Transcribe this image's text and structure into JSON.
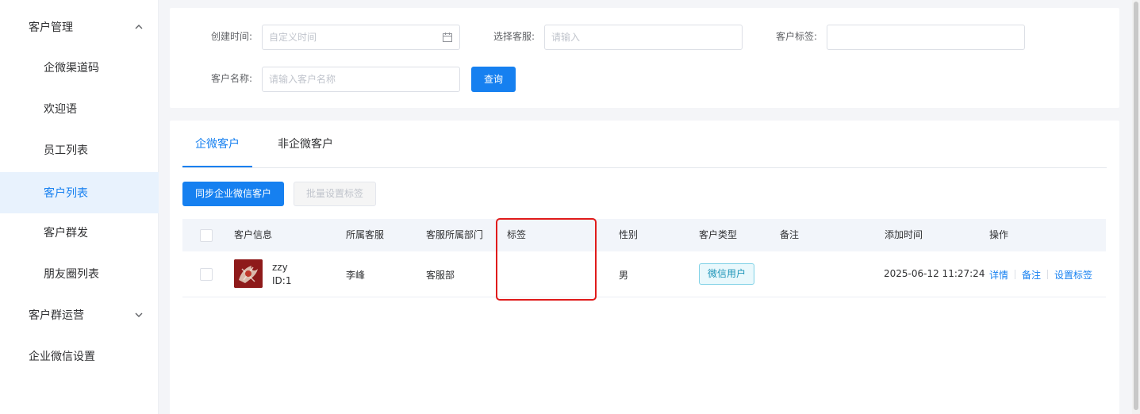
{
  "sidebar": {
    "groups": [
      {
        "label": "客户管理"
      },
      {
        "label": "客户群运营"
      },
      {
        "label": "企业微信设置"
      }
    ],
    "items": [
      {
        "label": "企微渠道码"
      },
      {
        "label": "欢迎语"
      },
      {
        "label": "员工列表"
      },
      {
        "label": "客户列表"
      },
      {
        "label": "客户群发"
      },
      {
        "label": "朋友圈列表"
      }
    ]
  },
  "filter": {
    "create_time_label": "创建时间:",
    "create_time_placeholder": "自定义时间",
    "agent_label": "选择客服:",
    "agent_placeholder": "请输入",
    "tag_label": "客户标签:",
    "tag_placeholder": "",
    "name_label": "客户名称:",
    "name_placeholder": "请输入客户名称",
    "query_button": "查询"
  },
  "tabs": [
    {
      "label": "企微客户"
    },
    {
      "label": "非企微客户"
    }
  ],
  "toolbar": {
    "sync_button": "同步企业微信客户",
    "batch_tag_button": "批量设置标签"
  },
  "table": {
    "columns": [
      "客户信息",
      "所属客服",
      "客服所属部门",
      "标签",
      "性别",
      "客户类型",
      "备注",
      "添加时间",
      "操作"
    ],
    "rows": [
      {
        "name": "zzy",
        "id": "ID:1",
        "agent": "李峰",
        "department": "客服部",
        "tags": "",
        "gender": "男",
        "customer_type": "微信用户",
        "remark": "",
        "added_time": "2025-06-12 11:27:24",
        "actions": [
          "详情",
          "备注",
          "设置标签"
        ]
      }
    ]
  },
  "colors": {
    "accent": "#1680f0",
    "highlight_box": "#e01b1b",
    "badge_border": "#7fd1e6"
  }
}
